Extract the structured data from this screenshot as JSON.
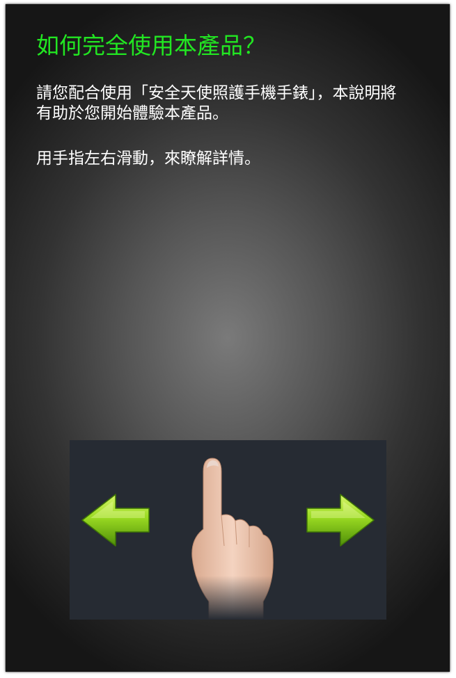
{
  "guide": {
    "title": "如何完全使用本產品？",
    "intro_lines": [
      "請您配合使用「安全天使照護手機手錶」，本說明將",
      "有助於您開始體驗本產品。"
    ],
    "instruction": "用手指左右滑動，來瞭解詳情。"
  },
  "gesture_illustration": {
    "icons": [
      "arrow-left-icon",
      "pointing-finger-icon",
      "arrow-right-icon"
    ]
  },
  "colors": {
    "title": "#22e622",
    "body_text": "#ffffff",
    "panel_background": "#262b33",
    "arrow_green": "#8fd21a"
  }
}
